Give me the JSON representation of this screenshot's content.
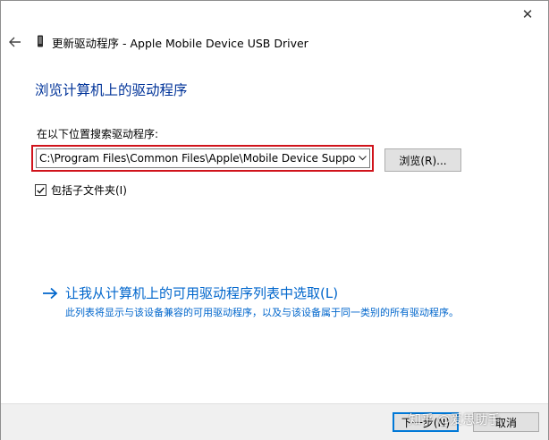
{
  "window": {
    "close_glyph": "✕",
    "title": "更新驱动程序 - Apple Mobile Device USB Driver",
    "back_icon": "back-arrow-icon",
    "device_icon": "usb-device-icon"
  },
  "main": {
    "heading": "浏览计算机上的驱动程序",
    "search_label": "在以下位置搜索驱动程序:",
    "path_value": "C:\\Program Files\\Common Files\\Apple\\Mobile Device Support",
    "browse_label": "浏览(R)...",
    "include_subfolders_label": "包括子文件夹(I)",
    "include_subfolders_checked": true,
    "pick_link_title": "让我从计算机上的可用驱动程序列表中选取(L)",
    "pick_link_desc": "此列表将显示与该设备兼容的可用驱动程序，以及与该设备属于同一类别的所有驱动程序。"
  },
  "footer": {
    "next_label": "下一步(N)",
    "cancel_label": "取消"
  },
  "watermark": "知乎 @爱思助手",
  "colors": {
    "heading": "#003399",
    "link": "#0066cc",
    "highlight": "#d0131b"
  }
}
